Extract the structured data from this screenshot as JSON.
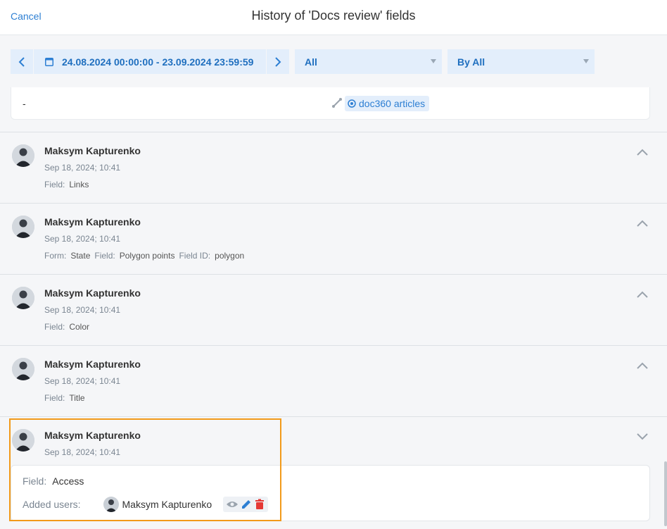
{
  "header": {
    "cancel_label": "Cancel",
    "title": "History of 'Docs review' fields"
  },
  "filters": {
    "date_range": "24.08.2024 00:00:00 - 23.09.2024 23:59:59",
    "type_filter": "All",
    "user_filter": "By All"
  },
  "previous_change": {
    "old_value": "-",
    "new_value_tag": "doc360 articles"
  },
  "entries": [
    {
      "user": "Maksym Kapturenko",
      "date": "Sep 18, 2024; 10:41",
      "meta": [
        {
          "k": "Field:",
          "v": "Links"
        }
      ],
      "expanded": false
    },
    {
      "user": "Maksym Kapturenko",
      "date": "Sep 18, 2024; 10:41",
      "meta": [
        {
          "k": "Form:",
          "v": "State"
        },
        {
          "k": "Field:",
          "v": "Polygon points"
        },
        {
          "k": "Field ID:",
          "v": "polygon"
        }
      ],
      "expanded": false
    },
    {
      "user": "Maksym Kapturenko",
      "date": "Sep 18, 2024; 10:41",
      "meta": [
        {
          "k": "Field:",
          "v": "Color"
        }
      ],
      "expanded": false
    },
    {
      "user": "Maksym Kapturenko",
      "date": "Sep 18, 2024; 10:41",
      "meta": [
        {
          "k": "Field:",
          "v": "Title"
        }
      ],
      "expanded": false
    },
    {
      "user": "Maksym Kapturenko",
      "date": "Sep 18, 2024; 10:41",
      "meta": [],
      "expanded": true
    }
  ],
  "detail": {
    "field_label": "Field:",
    "field_value": "Access",
    "added_users_label": "Added users:",
    "added_user": "Maksym Kapturenko"
  },
  "icons": [
    "chevron-left-icon",
    "calendar-icon",
    "chevron-right-icon",
    "link-icon",
    "target-icon",
    "chevron-up-icon",
    "chevron-down-icon",
    "eye-icon",
    "pencil-icon",
    "trash-icon"
  ],
  "colors": {
    "accent": "#2d7fd3",
    "highlight": "#f29a1a",
    "danger": "#e53935"
  }
}
